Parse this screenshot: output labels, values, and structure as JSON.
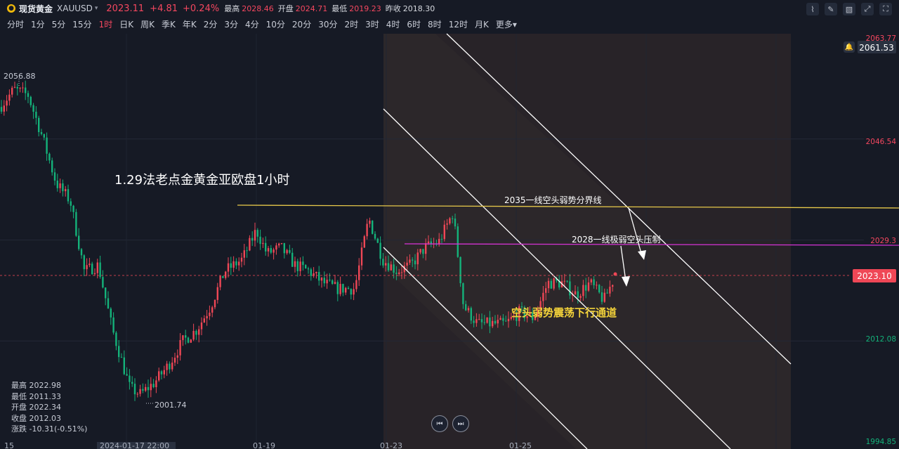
{
  "header": {
    "logo_glyph": "●",
    "symbol_name": "现货黄金",
    "symbol_code": "XAUUSD",
    "caret": "▾",
    "price": "2023.11",
    "change": "+4.81",
    "change_pct": "+0.24%",
    "stats": [
      {
        "label": "最高",
        "value": "2028.46",
        "tone": "red"
      },
      {
        "label": "开盘",
        "value": "2024.71",
        "tone": "red"
      },
      {
        "label": "最低",
        "value": "2019.23",
        "tone": "red"
      },
      {
        "label": "昨收",
        "value": "2018.30",
        "tone": "white"
      }
    ]
  },
  "toolbar_icons": [
    "chart-style-icon",
    "draw-pen-icon",
    "layers-icon",
    "expand-icon",
    "fullscreen-icon"
  ],
  "timeframes": {
    "items": [
      "分时",
      "1分",
      "5分",
      "15分",
      "1时",
      "日K",
      "周K",
      "季K",
      "年K",
      "2分",
      "3分",
      "4分",
      "10分",
      "20分",
      "30分",
      "2时",
      "3时",
      "4时",
      "6时",
      "8时",
      "12时",
      "月K",
      "更多▾"
    ],
    "active": "1时"
  },
  "axis": {
    "price_labels": [
      {
        "value": "2063.77",
        "tone": "red"
      },
      {
        "value": "2046.54",
        "tone": "red"
      },
      {
        "value": "2029.3",
        "tone": "red"
      },
      {
        "value": "2012.08",
        "tone": "green"
      },
      {
        "value": "1994.85",
        "tone": "green"
      }
    ],
    "current_price": "2023.10",
    "bell_price": "2061.53",
    "time_labels": [
      "15",
      "2024-01-17 22:00",
      "01-19",
      "01-23",
      "01-25"
    ]
  },
  "markers": {
    "high": "2056.88",
    "low": "2001.74"
  },
  "annotations": {
    "title": "1.29法老点金黄金亚欧盘1小时",
    "yellow_line_label": "2035一线空头弱势分界线",
    "magenta_line_label": "2028一线极弱空头压制",
    "channel_label": "空头弱势震荡下行通道"
  },
  "ohlc": [
    {
      "label": "最高",
      "value": "2022.98"
    },
    {
      "label": "最低",
      "value": "2011.33"
    },
    {
      "label": "开盘",
      "value": "2022.34"
    },
    {
      "label": "收盘",
      "value": "2012.03"
    },
    {
      "label": "涨跌",
      "value": "-10.31(-0.51%)"
    }
  ],
  "nav": {
    "prev": "⏮",
    "next": "⏭"
  },
  "colors": {
    "up": "#ef4756",
    "down": "#14b27a",
    "yellow": "#e6c84a",
    "magenta": "#d633d6",
    "bg": "#161a25"
  }
}
